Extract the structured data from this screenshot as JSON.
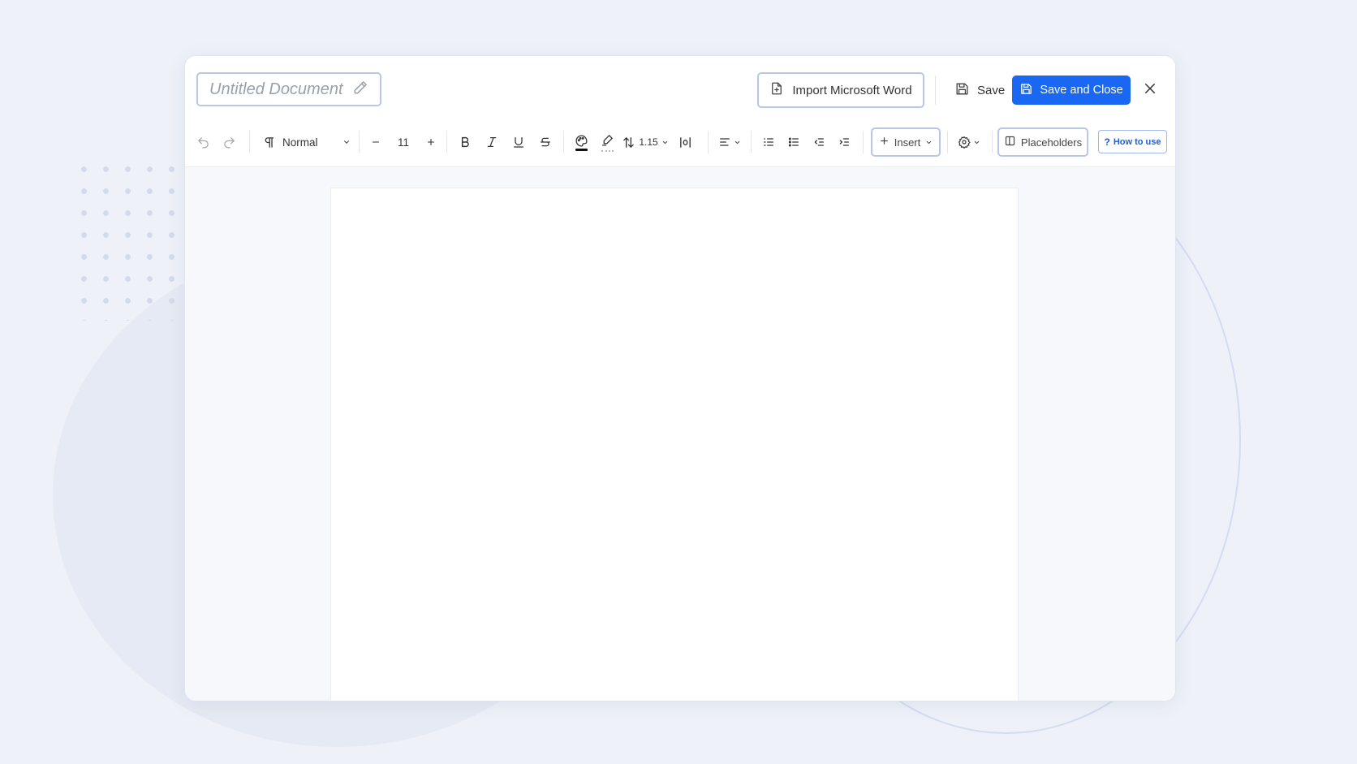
{
  "document": {
    "title_placeholder": "Untitled Document"
  },
  "header": {
    "import_label": "Import Microsoft Word",
    "save_label": "Save",
    "save_close_label": "Save and Close"
  },
  "toolbar": {
    "style_value": "Normal",
    "font_size": "11",
    "line_spacing": "1.15",
    "insert_label": "Insert",
    "placeholders_label": "Placeholders",
    "howto_label": "How to use"
  },
  "colors": {
    "primary": "#1967f2",
    "outline": "#b9c7e6",
    "text_color_swatch": "#111111"
  },
  "icons": [
    "pencil-icon",
    "word-import-icon",
    "save-icon",
    "close-icon",
    "undo-icon",
    "redo-icon",
    "paragraph-icon",
    "chevron-down-icon",
    "minus-icon",
    "plus-icon",
    "bold-icon",
    "italic-icon",
    "underline-icon",
    "strikethrough-icon",
    "palette-icon",
    "highlighter-icon",
    "line-spacing-icon",
    "text-direction-icon",
    "align-left-icon",
    "numbered-list-icon",
    "bulleted-list-icon",
    "outdent-icon",
    "indent-icon",
    "gear-icon",
    "panel-icon",
    "question-icon"
  ]
}
